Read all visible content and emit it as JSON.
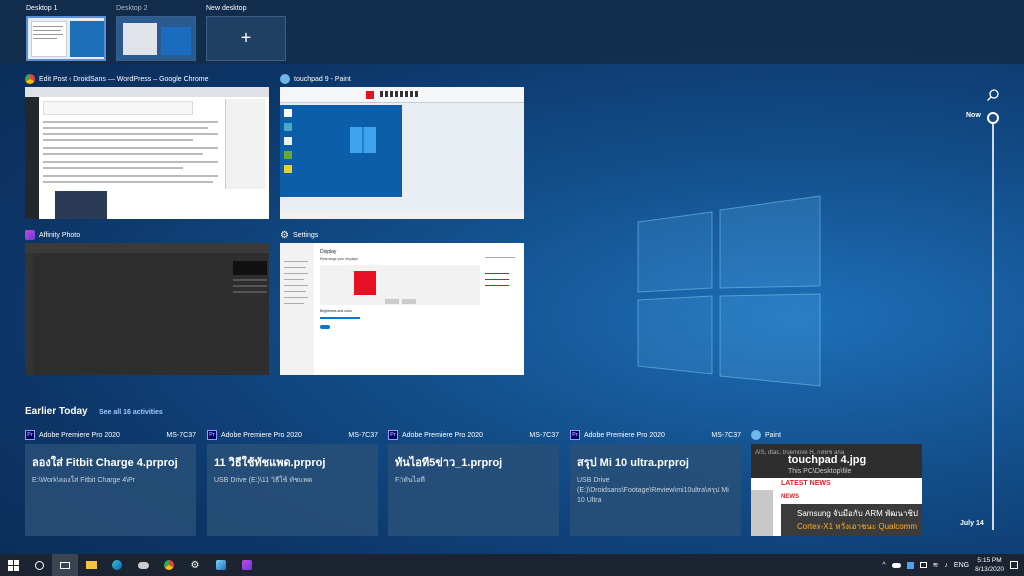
{
  "desktops": [
    {
      "label": "Desktop 1",
      "state": "active"
    },
    {
      "label": "Desktop 2",
      "state": "inactive"
    },
    {
      "label": "New desktop",
      "state": "new"
    }
  ],
  "new_desktop_glyph": "+",
  "windows": [
    {
      "title": "Edit Post ‹ DroidSans — WordPress – Google Chrome",
      "icon": "chrome-icon"
    },
    {
      "title": "touchpad 9 - Paint",
      "icon": "paint-icon"
    },
    {
      "title": "Affinity Photo",
      "icon": "affinity-photo-icon"
    },
    {
      "title": "Settings",
      "icon": "gear-icon"
    }
  ],
  "settings_shot": {
    "heading": "Display",
    "subheading": "Rearrange your displays",
    "brightness": "Brightness and color"
  },
  "earlier": {
    "title": "Earlier Today",
    "see_all": "See all 16 activities"
  },
  "activities": [
    {
      "app": "Adobe Premiere Pro 2020",
      "device": "MS-7C37",
      "file": "ลองใส่ Fitbit Charge 4.prproj",
      "path": "E:\\Work\\ลองใส่ Fitbit Charge 4\\Pr"
    },
    {
      "app": "Adobe Premiere Pro 2020",
      "device": "MS-7C37",
      "file": "11 วิธีใช้ทัชแพด.prproj",
      "path": "USB Drive (E:)\\11 วิธีใช้ ทัชแพด"
    },
    {
      "app": "Adobe Premiere Pro 2020",
      "device": "MS-7C37",
      "file": "ทันไอที5ข่าว_1.prproj",
      "path": "F:\\ทันไอที"
    },
    {
      "app": "Adobe Premiere Pro 2020",
      "device": "MS-7C37",
      "file": "สรุป Mi 10 ultra.prproj",
      "path": "USB Drive (E:)\\Droidsans\\Footage\\Review\\mi10ultra\\สรุป Mi 10 Ultra"
    },
    {
      "app": "Paint",
      "device": "",
      "file": "touchpad 4.jpg",
      "path": "This PC\\Desktop\\file",
      "news_title": "LATEST NEWS",
      "news_tag": "NEWS",
      "news_head1": "Samsung จับมือกับ ARM พัฒนาชิป",
      "news_head2": "Cortex-X1 หวังเอาชนะ Qualcomm",
      "news_top": "AIS, dtac, truemove H, กสทช ana"
    }
  ],
  "timeline": {
    "now": "Now",
    "date": "July 14"
  },
  "taskbar": {
    "apps": [
      "search-icon",
      "task-view-icon",
      "file-explorer-icon",
      "edge-icon",
      "cloud-icon",
      "chrome-icon",
      "settings-icon",
      "affinity-designer-icon",
      "affinity-photo-icon"
    ],
    "language": "ENG",
    "time": "5:15 PM",
    "date": "8/13/2020"
  },
  "colors": {
    "accent": "#0078d4",
    "premiere": "#9999ff",
    "taskbar": "#1b2430"
  }
}
